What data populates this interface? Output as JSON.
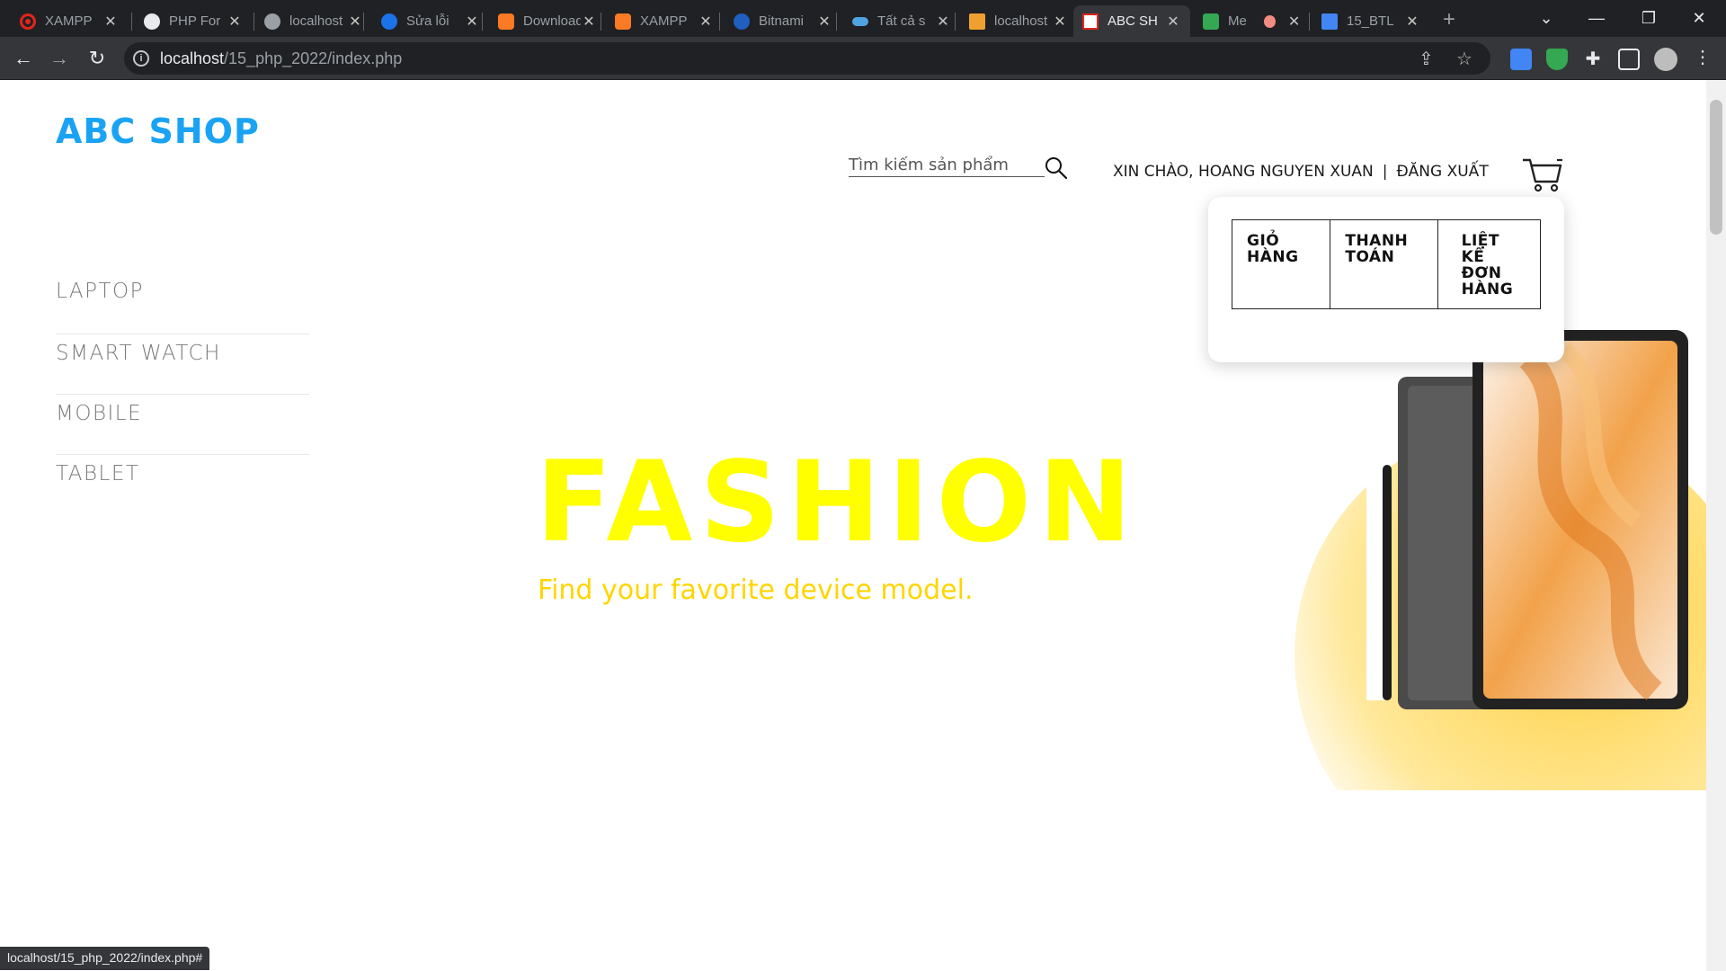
{
  "browser": {
    "tabs": [
      {
        "title": "XAMPP",
        "favicon": "opera-icon"
      },
      {
        "title": "PHP For",
        "favicon": "globe-icon"
      },
      {
        "title": "localhost",
        "favicon": "globe-icon"
      },
      {
        "title": "Sửa lỗi",
        "favicon": "edge-icon"
      },
      {
        "title": "Download",
        "favicon": "xampp-icon"
      },
      {
        "title": "XAMPP",
        "favicon": "xampp-icon"
      },
      {
        "title": "Bitnami",
        "favicon": "bitnami-icon"
      },
      {
        "title": "Tất cả s",
        "favicon": "toggle-icon"
      },
      {
        "title": "localhost",
        "favicon": "phpmyadmin-icon"
      },
      {
        "title": "ABC SH",
        "favicon": "abc-shop-icon",
        "active": true
      },
      {
        "title": "Me",
        "favicon": "meet-icon"
      },
      {
        "title": "15_BTL",
        "favicon": "docs-icon"
      }
    ],
    "url_host": "localhost",
    "url_path": "/15_php_2022/index.php",
    "status_url": "localhost/15_php_2022/index.php#"
  },
  "site": {
    "logo": "ABC SHOP",
    "nav": [
      "LAPTOP",
      "SMART WATCH",
      "MOBILE",
      "TABLET"
    ],
    "search_placeholder": "Tìm kiếm sản phẩm",
    "greeting": "XIN CHÀO, HOANG NGUYEN XUAN",
    "separator": "|",
    "logout": "ĐĂNG XUẤT",
    "cart_menu": [
      "GIỎ\nHÀNG",
      "THANH\nTOÁN",
      "LIỆT\nKÊ\nĐƠN\nHÀNG"
    ],
    "hero_title": "FASHION",
    "hero_subtitle": "Find your favorite device model."
  },
  "colors": {
    "logo": "#1aa3f4",
    "hero_title": "#ffff00",
    "hero_subtitle": "#ffd500",
    "chrome_dark": "#202124"
  }
}
